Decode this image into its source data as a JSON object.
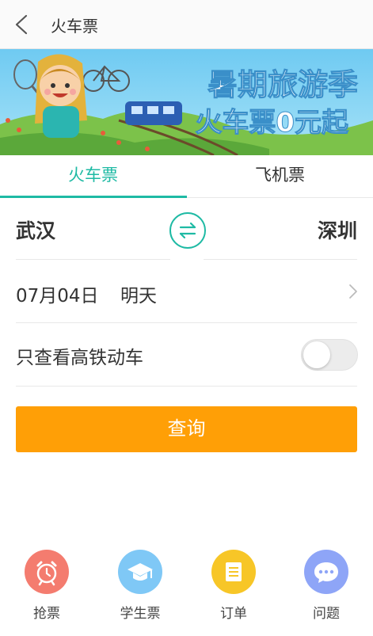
{
  "header": {
    "title": "火车票"
  },
  "banner": {
    "line1": "暑期旅游季",
    "line2": "火车票0元起"
  },
  "tabs": [
    {
      "label": "火车票",
      "active": true
    },
    {
      "label": "飞机票",
      "active": false
    }
  ],
  "route": {
    "from": "武汉",
    "to": "深圳"
  },
  "date": {
    "value": "07月04日",
    "day": "明天"
  },
  "filter": {
    "label": "只查看高铁动车",
    "enabled": false
  },
  "search": {
    "label": "查询"
  },
  "bottom_nav": [
    {
      "label": "抢票",
      "icon": "alarm-clock-icon",
      "color": "#f47c6f"
    },
    {
      "label": "学生票",
      "icon": "graduation-cap-icon",
      "color": "#7fc8f6"
    },
    {
      "label": "订单",
      "icon": "document-icon",
      "color": "#f7c627"
    },
    {
      "label": "问题",
      "icon": "chat-bubble-icon",
      "color": "#8ea5f7"
    }
  ],
  "colors": {
    "accent": "#1ebaa4",
    "search_button": "#ff9f06"
  }
}
